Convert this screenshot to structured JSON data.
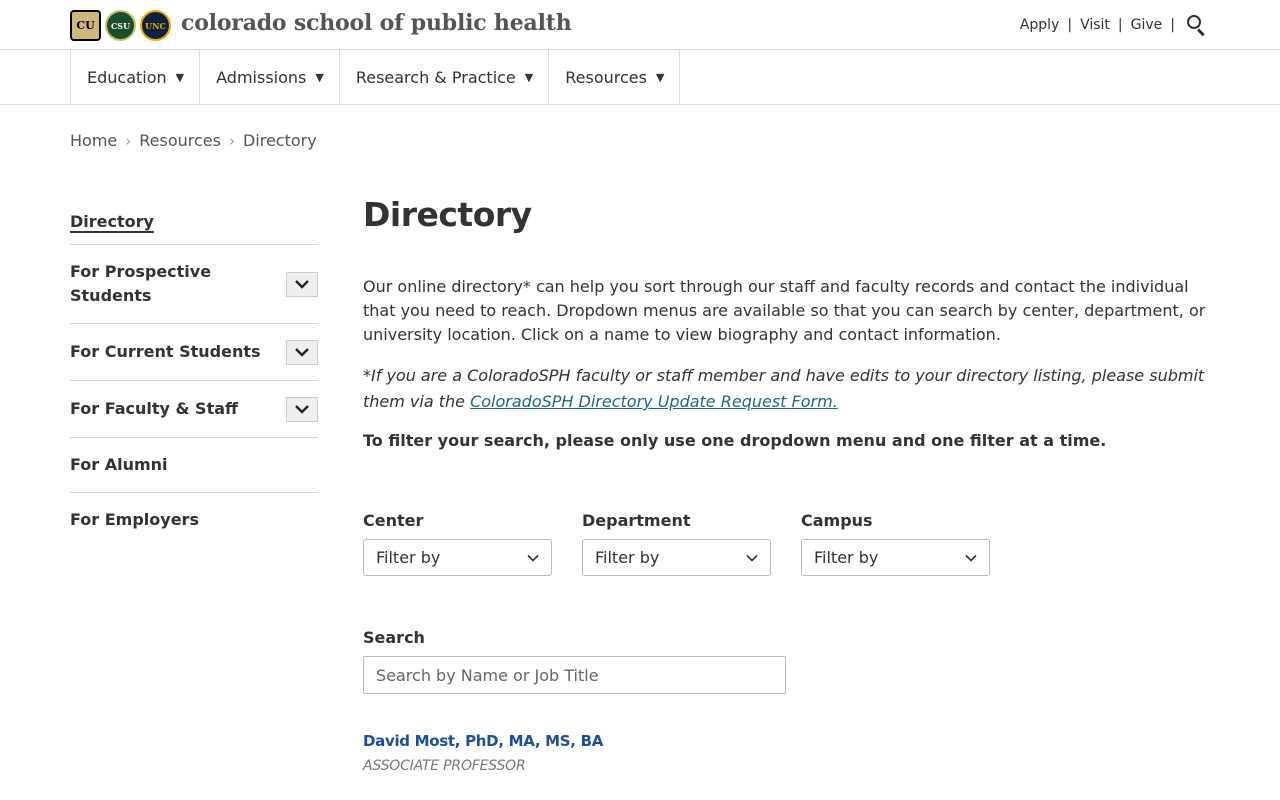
{
  "header": {
    "site_title": "colorado school of public health",
    "logos": [
      {
        "name": "cu-logo",
        "text": "CU"
      },
      {
        "name": "csu-logo",
        "text": "CSU"
      },
      {
        "name": "unc-logo",
        "text": "UNC"
      }
    ],
    "util_links": [
      "Apply",
      "Visit",
      "Give"
    ],
    "search_icon": "search-icon"
  },
  "nav": {
    "items": [
      {
        "label": "Education"
      },
      {
        "label": "Admissions"
      },
      {
        "label": "Research & Practice"
      },
      {
        "label": "Resources"
      }
    ]
  },
  "breadcrumb": [
    "Home",
    "Resources",
    "Directory"
  ],
  "sidebar": {
    "current": "Directory",
    "items": [
      {
        "label": "For Prospective Students",
        "expandable": true
      },
      {
        "label": "For Current Students",
        "expandable": true
      },
      {
        "label": "For Faculty & Staff",
        "expandable": true
      },
      {
        "label": "For Alumni",
        "expandable": false
      },
      {
        "label": "For Employers",
        "expandable": false
      }
    ]
  },
  "main": {
    "title": "Directory",
    "intro": "Our online directory* can help you sort through our staff and faculty records and contact the individual that you need to reach. Dropdown menus are available so that you can search by center, department, or university location. Click on a name to view biography and contact information.",
    "note_prefix": "*If you are a ColoradoSPH faculty or staff member and have edits to your directory listing, please submit them via the ",
    "note_link": "ColoradoSPH Directory Update Request Form.",
    "filter_tip": "To filter your search, please only use one dropdown menu and one filter at a time.",
    "filters": [
      {
        "label": "Center",
        "value": "Filter by"
      },
      {
        "label": "Department",
        "value": "Filter by"
      },
      {
        "label": "Campus",
        "value": "Filter by"
      }
    ],
    "search": {
      "label": "Search",
      "placeholder": "Search by Name or Job Title"
    },
    "results": [
      {
        "name": "David Most, PhD, MA, MS, BA",
        "title": "ASSOCIATE PROFESSOR"
      }
    ]
  },
  "colors": {
    "link": "#1a6a80",
    "name_link": "#1b4f9c",
    "border": "#dddddd"
  }
}
